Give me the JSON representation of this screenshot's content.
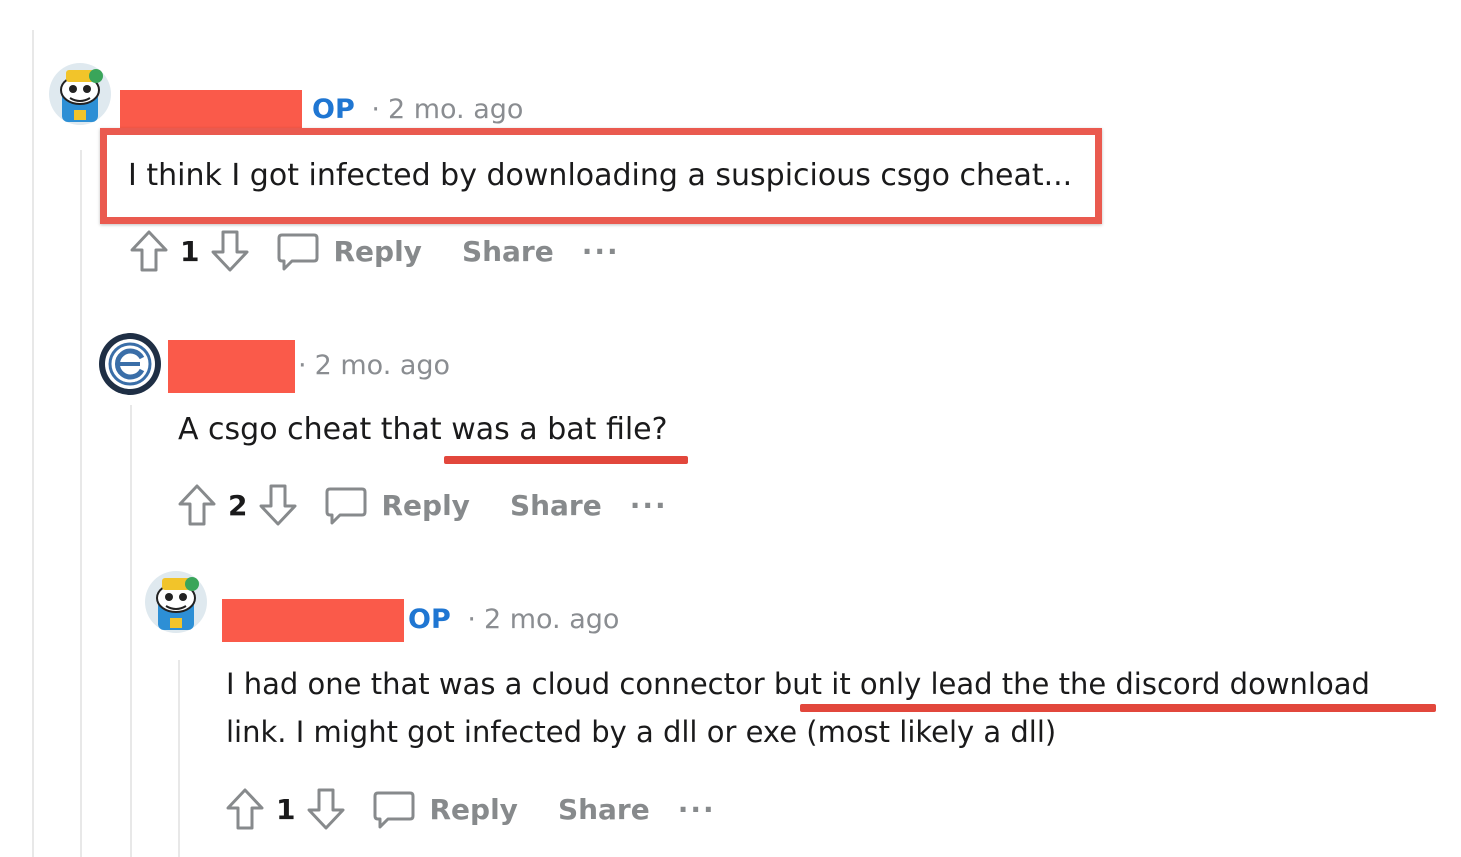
{
  "comments": [
    {
      "op_label": "OP",
      "separator": "·",
      "timestamp": "2 mo. ago",
      "body": "I think I got infected by downloading a suspicious csgo cheat...",
      "score": "1",
      "reply_label": "Reply",
      "share_label": "Share",
      "more_label": "···"
    },
    {
      "op_label": "",
      "separator": "·",
      "timestamp": "2 mo. ago",
      "body": "A csgo cheat that was a bat file?",
      "score": "2",
      "reply_label": "Reply",
      "share_label": "Share",
      "more_label": "···"
    },
    {
      "op_label": "OP",
      "separator": "·",
      "timestamp": "2 mo. ago",
      "body_line1": "I had one that was a cloud connector but it only lead the the discord download",
      "body_line2": "link. I might got infected by a dll or exe (most likely a dll)",
      "score": "1",
      "reply_label": "Reply",
      "share_label": "Share",
      "more_label": "···"
    }
  ],
  "colors": {
    "redaction": "#fa5a4a",
    "annotation": "#e2473c",
    "op_badge": "#1f76d2"
  },
  "icons": [
    "upvote-icon",
    "downvote-icon",
    "comment-bubble-icon",
    "snoo-avatar-icon",
    "emblem-avatar-icon"
  ]
}
